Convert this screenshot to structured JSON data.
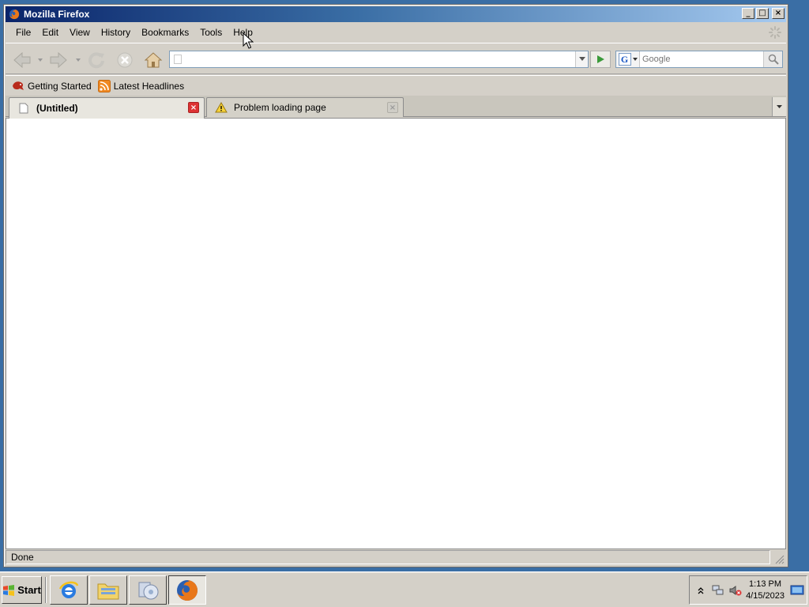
{
  "window": {
    "title": "Mozilla Firefox",
    "controls": {
      "minimize": "_",
      "maximize": "□",
      "close": "×"
    }
  },
  "menubar": {
    "items": [
      "File",
      "Edit",
      "View",
      "History",
      "Bookmarks",
      "Tools",
      "Help"
    ]
  },
  "navbar": {
    "url_value": "",
    "search_placeholder": "Google",
    "search_engine_letter": "G"
  },
  "bookmarks": {
    "items": [
      {
        "label": "Getting Started",
        "icon": "firefox-bookmark-icon"
      },
      {
        "label": "Latest Headlines",
        "icon": "rss-feed-icon"
      }
    ]
  },
  "tabs": [
    {
      "label": "(Untitled)",
      "active": true,
      "icon": "blank-page-icon"
    },
    {
      "label": "Problem loading page",
      "active": false,
      "icon": "warning-icon"
    }
  ],
  "statusbar": {
    "text": "Done"
  },
  "taskbar": {
    "start_label": "Start",
    "apps": [
      {
        "name": "internet-explorer"
      },
      {
        "name": "windows-explorer"
      },
      {
        "name": "media-player"
      },
      {
        "name": "firefox",
        "pressed": true
      }
    ],
    "clock": {
      "time": "1:13 PM",
      "date": "4/15/2023"
    }
  },
  "colors": {
    "title_gradient_start": "#0a246a",
    "title_gradient_end": "#a6caf0",
    "desktop": "#3a6ea5",
    "chrome": "#d4d0c8"
  }
}
